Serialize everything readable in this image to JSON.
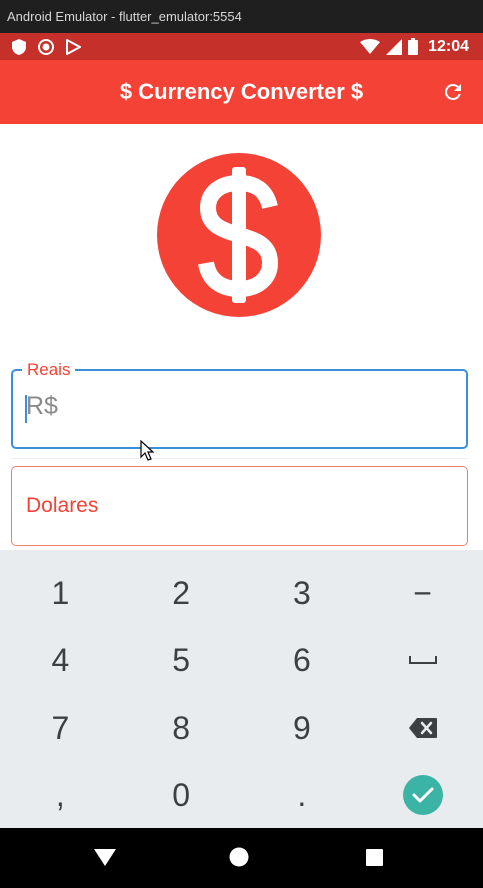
{
  "window": {
    "title": "Android Emulator - flutter_emulator:5554"
  },
  "status_bar": {
    "time": "12:04",
    "background": "#c6302a"
  },
  "app_bar": {
    "title": "$ Currency Converter $",
    "background": "#f44336"
  },
  "logo": {
    "symbol": "$",
    "color": "#f44336"
  },
  "fields": {
    "reais": {
      "label": "Reais",
      "prefix": "R$"
    },
    "dolares": {
      "label": "Dolares"
    }
  },
  "keyboard": {
    "rows": [
      [
        "1",
        "2",
        "3",
        "−"
      ],
      [
        "4",
        "5",
        "6",
        "space"
      ],
      [
        "7",
        "8",
        "9",
        "backspace"
      ],
      [
        ",",
        "0",
        ".",
        "done"
      ]
    ]
  },
  "colors": {
    "accent": "#f44336",
    "focus": "#3b8fd9",
    "done": "#3cb4a5"
  }
}
